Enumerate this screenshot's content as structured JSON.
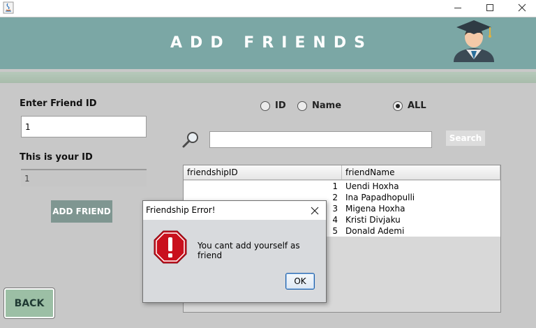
{
  "window": {
    "icons": {
      "app": "java-icon",
      "minimize": "minimize-icon",
      "maximize": "maximize-icon",
      "close": "close-icon"
    }
  },
  "header": {
    "title": "ADD FRIENDS",
    "avatar_icon": "graduate-icon",
    "color": "#7ba7a5"
  },
  "left_panel": {
    "enter_friend_id_label": "Enter Friend ID",
    "friend_id_value": "1",
    "your_id_label": "This is your ID",
    "your_id_value": "1",
    "add_friend_button": "ADD FRIEND",
    "back_button": "BACK"
  },
  "search": {
    "filters": [
      {
        "label": "ID",
        "selected": false
      },
      {
        "label": "Name",
        "selected": false
      },
      {
        "label": "ALL",
        "selected": true
      }
    ],
    "query": "",
    "button": "Search",
    "icon": "search-icon"
  },
  "table": {
    "columns": [
      "friendshipID",
      "friendName"
    ],
    "rows": [
      [
        "1",
        "Uendi Hoxha"
      ],
      [
        "2",
        "Ina Papadhopulli"
      ],
      [
        "3",
        "Migena Hoxha"
      ],
      [
        "4",
        "Kristi Divjaku"
      ],
      [
        "5",
        "Donald Ademi"
      ]
    ]
  },
  "dialog": {
    "title": "Friendship Error!",
    "message": "You cant add yourself as friend",
    "ok_button": "OK",
    "icon": "error-stop-icon"
  }
}
